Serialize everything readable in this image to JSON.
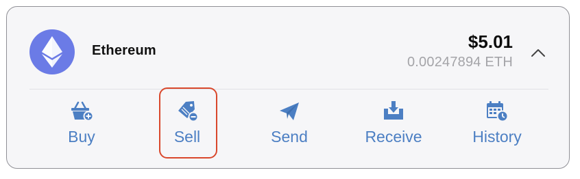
{
  "coin": {
    "name": "Ethereum",
    "icon": "ethereum-icon",
    "icon_bg_color": "#6b7be6",
    "fiat_value": "$5.01",
    "crypto_value": "0.00247894 ETH",
    "expanded": true,
    "chevron_icon": "chevron-up-icon"
  },
  "actions": [
    {
      "label": "Buy",
      "icon": "basket-plus-icon"
    },
    {
      "label": "Sell",
      "icon": "tag-minus-icon",
      "highlighted": true
    },
    {
      "label": "Send",
      "icon": "paper-plane-icon"
    },
    {
      "label": "Receive",
      "icon": "inbox-download-icon"
    },
    {
      "label": "History",
      "icon": "calendar-clock-icon"
    }
  ],
  "colors": {
    "accent": "#4c7fc3",
    "highlight_border": "#d9472b",
    "muted_text": "#a4a4a8"
  }
}
